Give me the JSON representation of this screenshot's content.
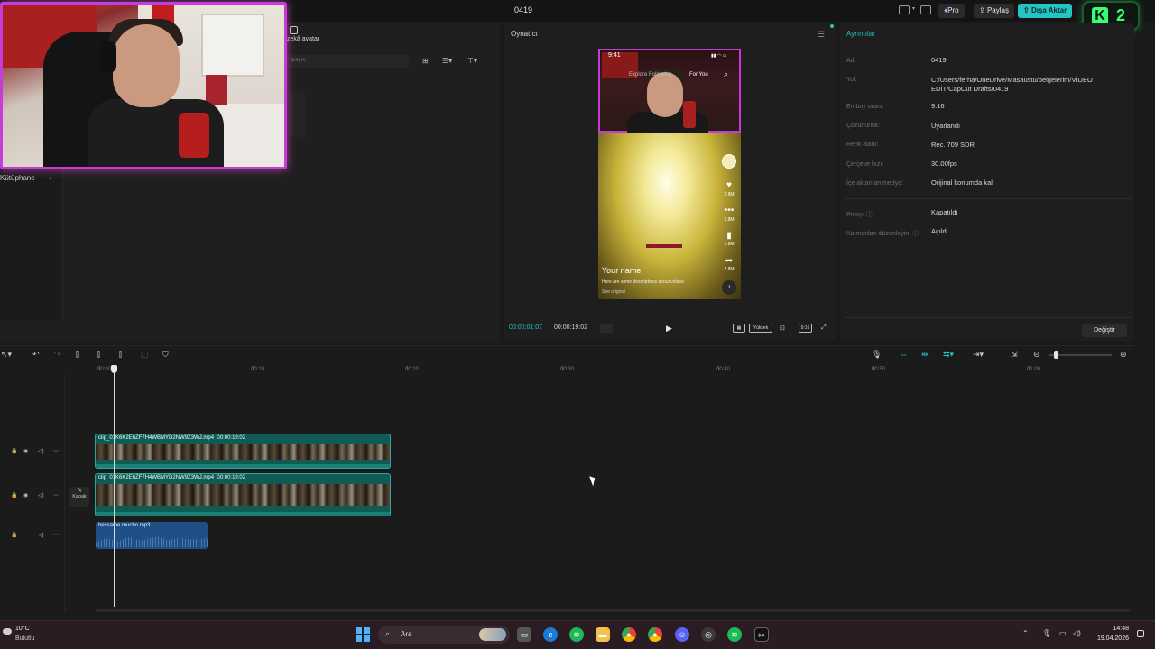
{
  "project": {
    "title": "0419"
  },
  "topbar": {
    "pro_label": "Pro",
    "share_label": "Paylaş",
    "export_label": "Dışa Aktar"
  },
  "overlay": {
    "kick_letter": "K",
    "kick_number": "2"
  },
  "media": {
    "avatar_tab": "zekâ avatar",
    "search_placeholder": "arayın",
    "library_label": "Kütüphane"
  },
  "player": {
    "title": "Oynatıcı",
    "current_time": "00:00:01:07",
    "total_time": "00:00:19:02",
    "quality_label": "Yüksek",
    "ratio_label": "9:16",
    "phone": {
      "time": "9:41",
      "tab_explore": "Explore",
      "tab_following": "Following",
      "tab_for_you": "For You",
      "name": "Your name",
      "description": "Here are some descriptions about videos",
      "see_original": "See original",
      "count_like": "2.8M",
      "count_comment": "2.8M",
      "count_save": "2.8M",
      "count_share": "2.8M"
    }
  },
  "details": {
    "title": "Ayrıntılar",
    "rows": [
      {
        "label": "Ad:",
        "value": "0419"
      },
      {
        "label": "Yol:",
        "value": "C:/Users/ferha/OneDrive/Masaüstü/belgelerim/VİDEO EDİT/CapCut Drafts/0419"
      },
      {
        "label": "En boy oranı:",
        "value": "9:16"
      },
      {
        "label": "Çözünürlük:",
        "value": "Uyarlandı"
      },
      {
        "label": "Renk alanı:",
        "value": "Rec. 709 SDR"
      },
      {
        "label": "Çerçeve hızı:",
        "value": "30.00fps"
      },
      {
        "label": "İçe aktarılan medya:",
        "value": "Orijinal konumda kal"
      },
      {
        "label": "Proxy:",
        "value": "Kapatıldı"
      },
      {
        "label": "Katmanları düzenleyin:",
        "value": "Açıldı"
      }
    ],
    "change_button": "Değiştir"
  },
  "timeline": {
    "ticks": [
      "00:00",
      "00:10",
      "00:20",
      "00:30",
      "00:40",
      "00:50",
      "01:00"
    ],
    "cover_label": "Kapak",
    "clips": [
      {
        "name": "clip_01K6K2E6ZF7H4WBMYD2NW9Z3WJ.mp4",
        "duration": "00:00:19:02"
      },
      {
        "name": "clip_01K6K2E6ZF7H4WBMYD2NW9Z3WJ.mp4",
        "duration": "00:00:19:02"
      }
    ],
    "audio": {
      "name": "bessame mucho.mp3"
    }
  },
  "taskbar": {
    "temperature": "10°C",
    "weather": "Bulutlu",
    "search_label": "Ara",
    "time": "14:48",
    "date": "19.04.2026"
  },
  "colors": {
    "accent": "#23c4c4",
    "clip": "#0f5c54",
    "audio": "#1f4f84",
    "webcam_border": "#c93bd6"
  }
}
